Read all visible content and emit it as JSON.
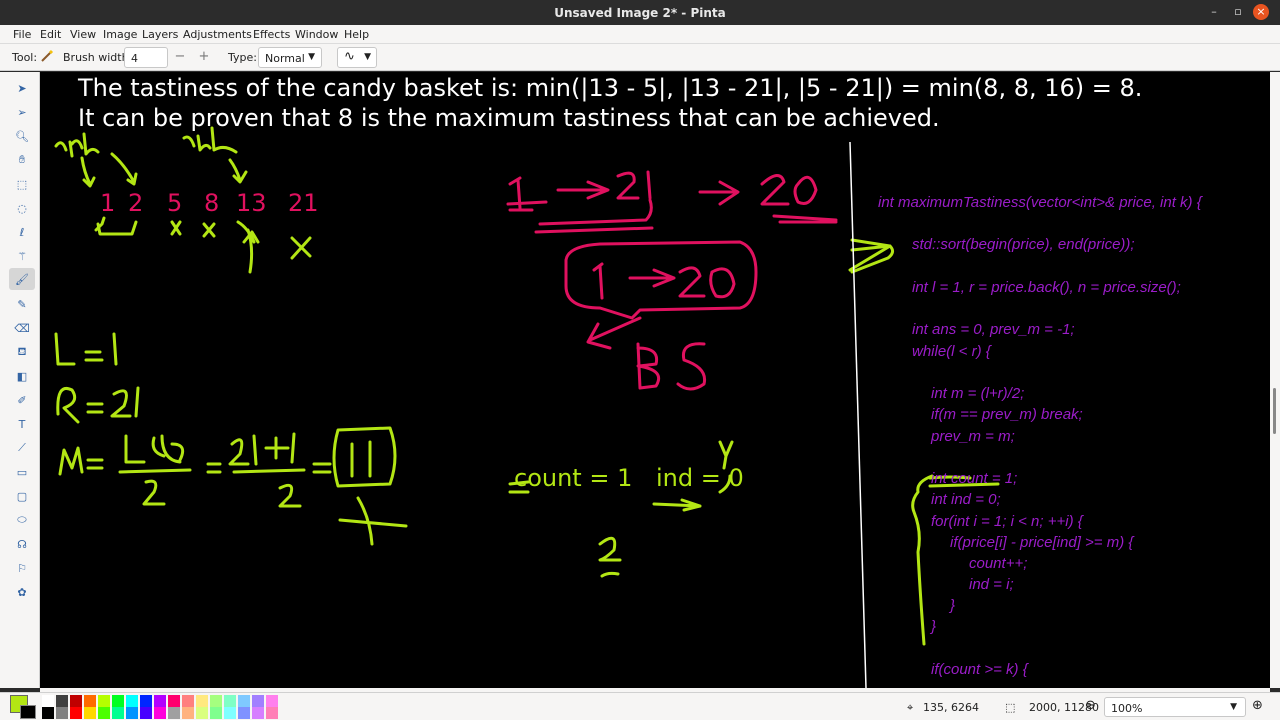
{
  "window": {
    "title": "Unsaved Image 2* - Pinta"
  },
  "menu": [
    "File",
    "Edit",
    "View",
    "Image",
    "Layers",
    "Adjustments",
    "Effects",
    "Window",
    "Help"
  ],
  "toolbar": {
    "tool_label": "Tool:",
    "brush_width_label": "Brush width:",
    "brush_width_value": "4",
    "minus": "−",
    "plus": "+",
    "type_label": "Type:",
    "type_value": "Normal"
  },
  "canvas": {
    "problem_line1": "The tastiness of the candy basket is: min(|13 - 5|, |13 - 21|, |5 - 21|) = min(8, 8, 16) = 8.",
    "problem_line2": "It can be proven that 8 is the maximum tastiness that can be achieved.",
    "numbers": [
      "1",
      "2",
      "5",
      "8",
      "13",
      "21"
    ],
    "count_text": "count = 1",
    "ind_text": "ind = 0",
    "code": [
      "int maximumTastiness(vector<int>& price, int k) {",
      "std::sort(begin(price), end(price));",
      "int l = 1, r = price.back(), n = price.size();",
      "int ans = 0, prev_m = -1;",
      "while(l < r) {",
      "int m  = (l+r)/2;",
      "if(m == prev_m) break;",
      "prev_m = m;",
      "int count = 1;",
      "int ind = 0;",
      "for(int i = 1; i < n; ++i) {",
      "if(price[i] - price[ind] >= m) {",
      "count++;",
      "ind = i;",
      "}",
      "}",
      "if(count >= k) {"
    ]
  },
  "status": {
    "cursor_pos": "135, 6264",
    "selection_size": "2000, 11280",
    "zoom": "100%"
  },
  "colors": {
    "pink": "#e0115f",
    "green": "#b3e614",
    "purple": "#9b1dc9",
    "primary": "#b3e614",
    "secondary": "#000000"
  },
  "palette": [
    "#ffffff",
    "#000000",
    "#404040",
    "#808080",
    "#c00000",
    "#ff0000",
    "#ff6a00",
    "#ffd800",
    "#b6ff00",
    "#4cff00",
    "#00ff21",
    "#00ff90",
    "#00ffff",
    "#0094ff",
    "#0026ff",
    "#4800ff",
    "#b200ff",
    "#ff00dc",
    "#ff006e",
    "#a0a0a0",
    "#ff7f7f",
    "#ffb27f",
    "#ffe97f",
    "#daff7f",
    "#a5ff7f",
    "#7fff8e",
    "#7fffc5",
    "#7fffff",
    "#7fc9ff",
    "#7f92ff",
    "#a17fff",
    "#d67fff",
    "#ff7fed",
    "#ff7fb6"
  ]
}
